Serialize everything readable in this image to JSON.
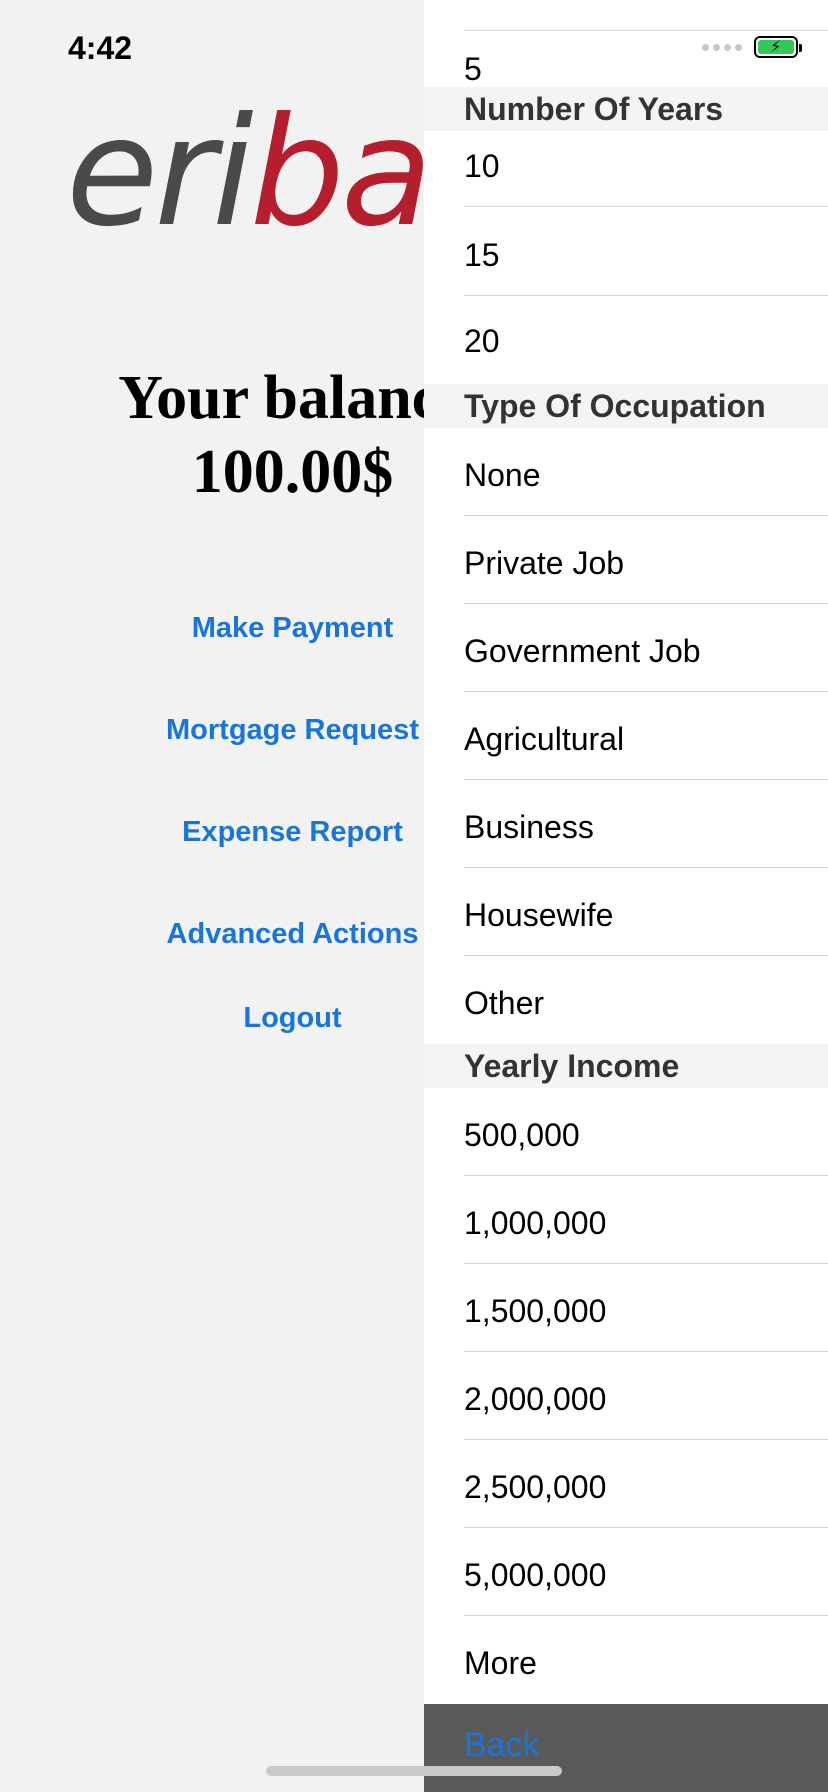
{
  "status_bar": {
    "time": "4:42"
  },
  "logo": {
    "part1": "eri",
    "part2": "ban"
  },
  "balance": {
    "label": "Your balance",
    "amount": "100.00$"
  },
  "menu": {
    "make_payment": "Make Payment",
    "mortgage_request": "Mortgage Request",
    "expense_report": "Expense Report",
    "advanced_actions": "Advanced Actions",
    "logout": "Logout"
  },
  "panel": {
    "top_item": "5",
    "sections": [
      {
        "title": "Number Of Years",
        "items": [
          "10",
          "15",
          "20"
        ]
      },
      {
        "title": "Type Of Occupation",
        "items": [
          "None",
          "Private Job",
          "Government Job",
          "Agricultural",
          "Business",
          "Housewife",
          "Other"
        ]
      },
      {
        "title": "Yearly Income",
        "items": [
          "500,000",
          "1,000,000",
          "1,500,000",
          "2,000,000",
          "2,500,000",
          "5,000,000",
          "More"
        ]
      }
    ],
    "back_label": "Back"
  },
  "colors": {
    "accent": "#1a75d9",
    "brand_red": "#b41e2d",
    "battery_green": "#34c759"
  }
}
